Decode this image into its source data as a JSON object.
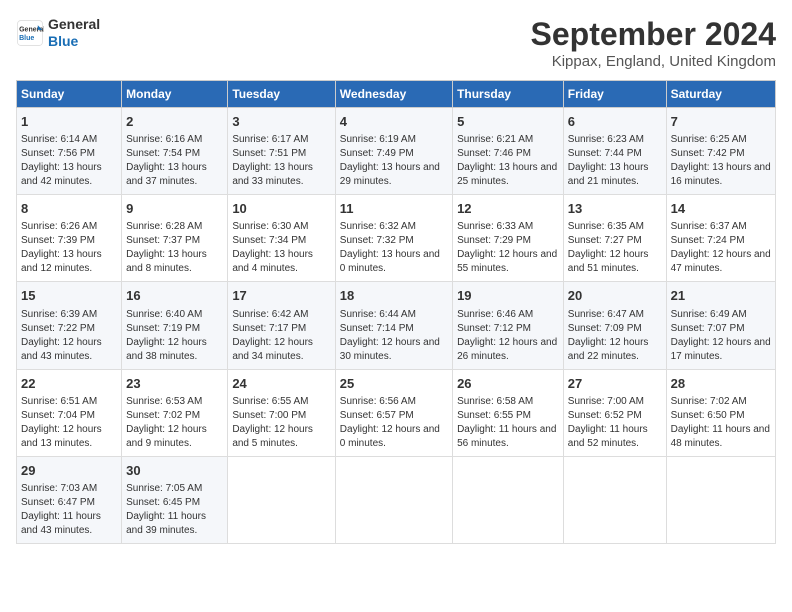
{
  "logo": {
    "line1": "General",
    "line2": "Blue"
  },
  "title": "September 2024",
  "subtitle": "Kippax, England, United Kingdom",
  "days_header": [
    "Sunday",
    "Monday",
    "Tuesday",
    "Wednesday",
    "Thursday",
    "Friday",
    "Saturday"
  ],
  "weeks": [
    [
      {
        "day": "1",
        "sunrise": "6:14 AM",
        "sunset": "7:56 PM",
        "daylight": "13 hours and 42 minutes."
      },
      {
        "day": "2",
        "sunrise": "6:16 AM",
        "sunset": "7:54 PM",
        "daylight": "13 hours and 37 minutes."
      },
      {
        "day": "3",
        "sunrise": "6:17 AM",
        "sunset": "7:51 PM",
        "daylight": "13 hours and 33 minutes."
      },
      {
        "day": "4",
        "sunrise": "6:19 AM",
        "sunset": "7:49 PM",
        "daylight": "13 hours and 29 minutes."
      },
      {
        "day": "5",
        "sunrise": "6:21 AM",
        "sunset": "7:46 PM",
        "daylight": "13 hours and 25 minutes."
      },
      {
        "day": "6",
        "sunrise": "6:23 AM",
        "sunset": "7:44 PM",
        "daylight": "13 hours and 21 minutes."
      },
      {
        "day": "7",
        "sunrise": "6:25 AM",
        "sunset": "7:42 PM",
        "daylight": "13 hours and 16 minutes."
      }
    ],
    [
      {
        "day": "8",
        "sunrise": "6:26 AM",
        "sunset": "7:39 PM",
        "daylight": "13 hours and 12 minutes."
      },
      {
        "day": "9",
        "sunrise": "6:28 AM",
        "sunset": "7:37 PM",
        "daylight": "13 hours and 8 minutes."
      },
      {
        "day": "10",
        "sunrise": "6:30 AM",
        "sunset": "7:34 PM",
        "daylight": "13 hours and 4 minutes."
      },
      {
        "day": "11",
        "sunrise": "6:32 AM",
        "sunset": "7:32 PM",
        "daylight": "13 hours and 0 minutes."
      },
      {
        "day": "12",
        "sunrise": "6:33 AM",
        "sunset": "7:29 PM",
        "daylight": "12 hours and 55 minutes."
      },
      {
        "day": "13",
        "sunrise": "6:35 AM",
        "sunset": "7:27 PM",
        "daylight": "12 hours and 51 minutes."
      },
      {
        "day": "14",
        "sunrise": "6:37 AM",
        "sunset": "7:24 PM",
        "daylight": "12 hours and 47 minutes."
      }
    ],
    [
      {
        "day": "15",
        "sunrise": "6:39 AM",
        "sunset": "7:22 PM",
        "daylight": "12 hours and 43 minutes."
      },
      {
        "day": "16",
        "sunrise": "6:40 AM",
        "sunset": "7:19 PM",
        "daylight": "12 hours and 38 minutes."
      },
      {
        "day": "17",
        "sunrise": "6:42 AM",
        "sunset": "7:17 PM",
        "daylight": "12 hours and 34 minutes."
      },
      {
        "day": "18",
        "sunrise": "6:44 AM",
        "sunset": "7:14 PM",
        "daylight": "12 hours and 30 minutes."
      },
      {
        "day": "19",
        "sunrise": "6:46 AM",
        "sunset": "7:12 PM",
        "daylight": "12 hours and 26 minutes."
      },
      {
        "day": "20",
        "sunrise": "6:47 AM",
        "sunset": "7:09 PM",
        "daylight": "12 hours and 22 minutes."
      },
      {
        "day": "21",
        "sunrise": "6:49 AM",
        "sunset": "7:07 PM",
        "daylight": "12 hours and 17 minutes."
      }
    ],
    [
      {
        "day": "22",
        "sunrise": "6:51 AM",
        "sunset": "7:04 PM",
        "daylight": "12 hours and 13 minutes."
      },
      {
        "day": "23",
        "sunrise": "6:53 AM",
        "sunset": "7:02 PM",
        "daylight": "12 hours and 9 minutes."
      },
      {
        "day": "24",
        "sunrise": "6:55 AM",
        "sunset": "7:00 PM",
        "daylight": "12 hours and 5 minutes."
      },
      {
        "day": "25",
        "sunrise": "6:56 AM",
        "sunset": "6:57 PM",
        "daylight": "12 hours and 0 minutes."
      },
      {
        "day": "26",
        "sunrise": "6:58 AM",
        "sunset": "6:55 PM",
        "daylight": "11 hours and 56 minutes."
      },
      {
        "day": "27",
        "sunrise": "7:00 AM",
        "sunset": "6:52 PM",
        "daylight": "11 hours and 52 minutes."
      },
      {
        "day": "28",
        "sunrise": "7:02 AM",
        "sunset": "6:50 PM",
        "daylight": "11 hours and 48 minutes."
      }
    ],
    [
      {
        "day": "29",
        "sunrise": "7:03 AM",
        "sunset": "6:47 PM",
        "daylight": "11 hours and 43 minutes."
      },
      {
        "day": "30",
        "sunrise": "7:05 AM",
        "sunset": "6:45 PM",
        "daylight": "11 hours and 39 minutes."
      },
      null,
      null,
      null,
      null,
      null
    ]
  ]
}
